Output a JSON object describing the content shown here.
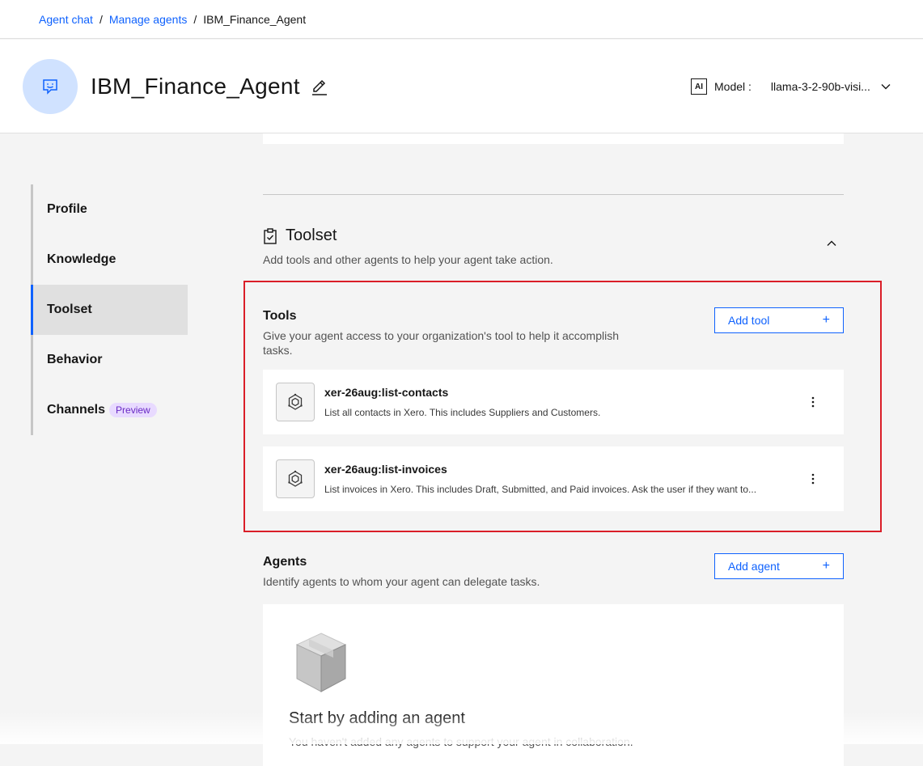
{
  "breadcrumb": {
    "items": [
      "Agent chat",
      "Manage agents"
    ],
    "separator": "/",
    "current": "IBM_Finance_Agent"
  },
  "header": {
    "title": "IBM_Finance_Agent",
    "ai_badge": "AI",
    "model_label": "Model :",
    "model_value": "llama-3-2-90b-visi..."
  },
  "sidebar": {
    "items": [
      {
        "label": "Profile"
      },
      {
        "label": "Knowledge"
      },
      {
        "label": "Toolset"
      },
      {
        "label": "Behavior"
      },
      {
        "label": "Channels",
        "tag": "Preview"
      }
    ]
  },
  "toolset": {
    "title": "Toolset",
    "description": "Add tools and other agents to help your agent take action."
  },
  "tools": {
    "title": "Tools",
    "description": "Give your agent access to your organization's tool to help it accomplish tasks.",
    "add_label": "Add tool",
    "items": [
      {
        "name": "xer-26aug:list-contacts",
        "description": "List all contacts in Xero. This includes Suppliers and Customers."
      },
      {
        "name": "xer-26aug:list-invoices",
        "description": "List invoices in Xero. This includes Draft, Submitted, and Paid invoices. Ask the user if they want to..."
      }
    ]
  },
  "agents": {
    "title": "Agents",
    "description": "Identify agents to whom your agent can delegate tasks.",
    "add_label": "Add agent",
    "empty_title": "Start by adding an agent",
    "empty_description": "You haven't added any agents to support your agent in collaboration."
  },
  "colors": {
    "accent": "#0f62fe",
    "highlight": "#da1e28",
    "preview_tag": "#6929c4"
  }
}
